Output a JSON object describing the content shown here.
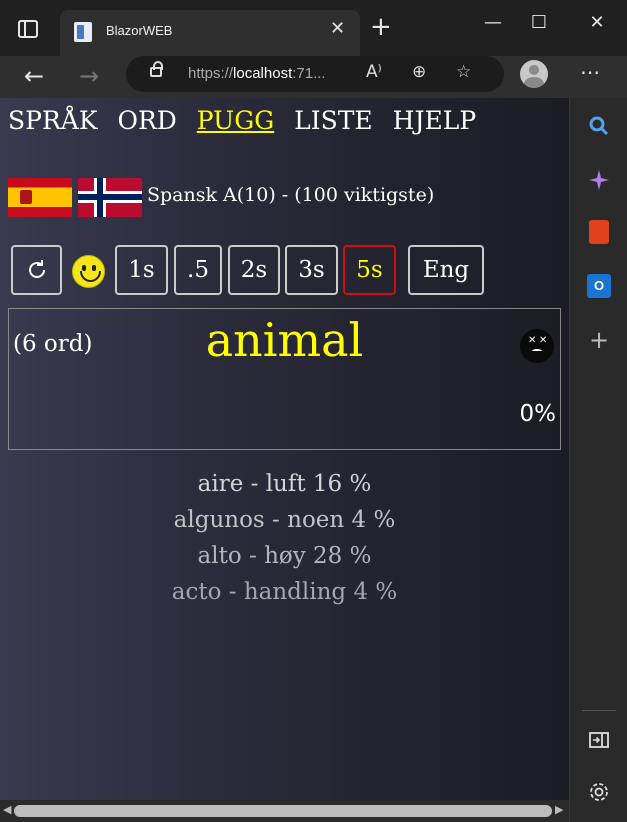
{
  "browser": {
    "tab_title": "BlazorWEB",
    "url_scheme": "https://",
    "url_host": "localhost",
    "url_rest": ":71...",
    "icons": [
      "tab-actions-icon",
      "back-arrow-icon",
      "forward-arrow-icon",
      "lock-icon",
      "read-aloud-icon",
      "zoom-icon",
      "favorites-add-icon",
      "profile-avatar-icon",
      "more-icon",
      "minimize-icon",
      "maximize-icon",
      "close-icon"
    ]
  },
  "sidebar": {
    "icons": [
      "search-icon",
      "copilot-icon",
      "office-icon",
      "outlook-icon",
      "add-icon",
      "split-screen-icon",
      "settings-icon"
    ]
  },
  "nav": {
    "sprak": "SPRÅK",
    "ord": "ORD",
    "pugg": "PUGG",
    "liste": "LISTE",
    "hjelp": "HJELP",
    "active": "PUGG"
  },
  "course": {
    "label": "Spansk A(10) - (100 viktigste)",
    "flags": [
      "spain-flag",
      "norway-flag"
    ]
  },
  "controls": {
    "refresh_icon": "refresh-icon",
    "smiley_icon": "smiley-icon",
    "t1": "1s",
    "t2": ".5",
    "t3": "2s",
    "t4": "3s",
    "t5": "5s",
    "lang": "Eng",
    "selected": "5s",
    "selected_color": "#d01010",
    "accent": "#ffff00"
  },
  "card": {
    "count": "(6 ord)",
    "word": "animal",
    "percent": "0%",
    "status_icon": "dead-face-icon"
  },
  "results": [
    "aire - luft 16 %",
    "algunos - noen 4 %",
    "alto - høy 28 %",
    "acto - handling 4 %"
  ]
}
